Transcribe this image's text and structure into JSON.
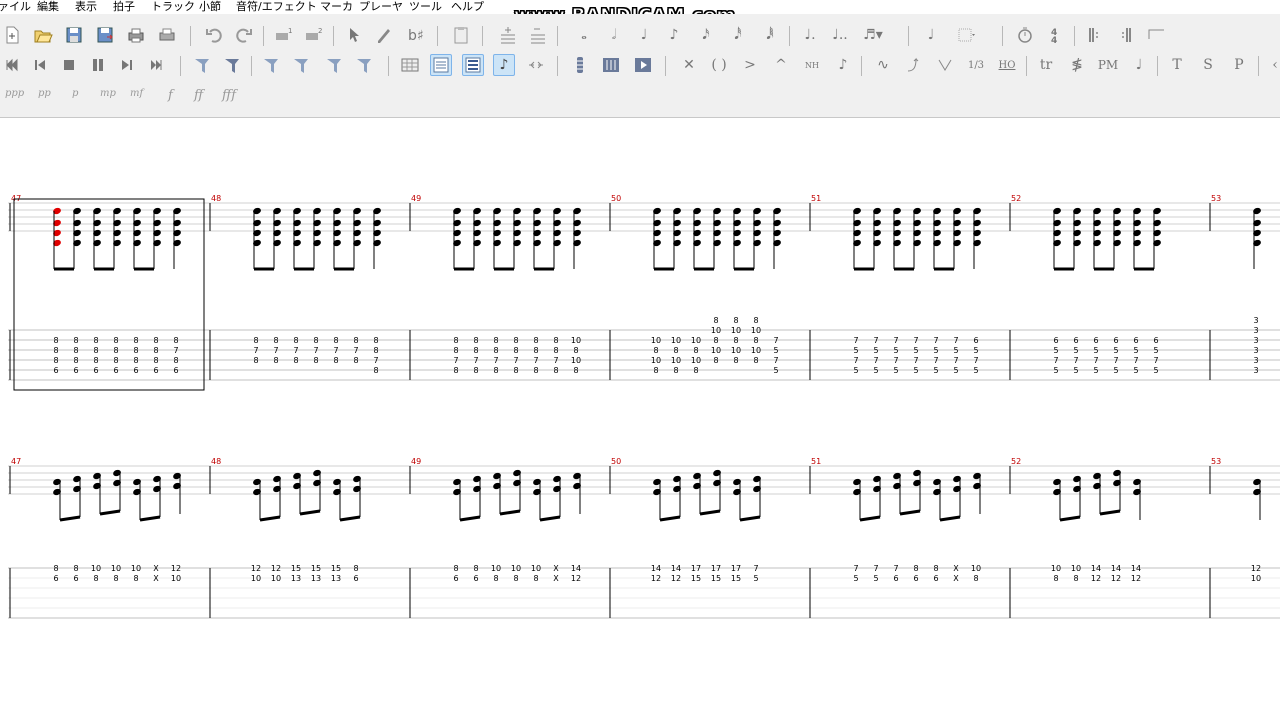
{
  "menu": {
    "items": [
      "ァイル",
      "編集",
      "表示",
      "拍子",
      "トラック",
      "小節",
      "音符/エフェクト",
      "マーカ",
      "プレーヤ",
      "ツール",
      "ヘルプ"
    ]
  },
  "watermark": "www.BANDICAM.com",
  "toolbar": {
    "dynamics": [
      "ppp",
      "pp",
      "p",
      "mp",
      "mf",
      "f",
      "ff",
      "fff"
    ],
    "letter_buttons": [
      "tr",
      "PM",
      "T",
      "S",
      "P"
    ],
    "fraction_label": "1/3",
    "ho_label": "HO",
    "nh_label": "NH",
    "active_icons": [
      "page-view-icon",
      "multitrack-view-icon",
      "note-view-icon"
    ]
  },
  "score": {
    "systems": [
      {
        "measures": [
          {
            "number": "47",
            "tab": [
              [
                "8",
                "8",
                "8",
                "6"
              ],
              [
                "8",
                "8",
                "8",
                "6"
              ],
              [
                "8",
                "8",
                "8",
                "6"
              ],
              [
                "8",
                "8",
                "8",
                "6"
              ],
              [
                "8",
                "8",
                "8",
                "6"
              ],
              [
                "8",
                "8",
                "8",
                "6"
              ],
              [
                "8",
                "7",
                "8",
                "6"
              ]
            ]
          },
          {
            "number": "48",
            "tab": [
              [
                "8",
                "7",
                "8",
                ""
              ],
              [
                "8",
                "7",
                "8",
                ""
              ],
              [
                "8",
                "7",
                "8",
                ""
              ],
              [
                "8",
                "7",
                "8",
                ""
              ],
              [
                "8",
                "7",
                "8",
                ""
              ],
              [
                "8",
                "7",
                "8",
                ""
              ],
              [
                "8",
                "8",
                "7",
                "8"
              ]
            ]
          },
          {
            "number": "49",
            "tab": [
              [
                "8",
                "8",
                "7",
                "8"
              ],
              [
                "8",
                "8",
                "7",
                "8"
              ],
              [
                "8",
                "8",
                "7",
                "8"
              ],
              [
                "8",
                "8",
                "7",
                "8"
              ],
              [
                "8",
                "8",
                "7",
                "8"
              ],
              [
                "8",
                "8",
                "7",
                "8"
              ],
              [
                "10",
                "8",
                "10",
                "8"
              ]
            ]
          },
          {
            "number": "50",
            "tab": [
              [
                "10",
                "8",
                "10",
                "8"
              ],
              [
                "10",
                "8",
                "10",
                "8"
              ],
              [
                "10",
                "8",
                "10",
                "8"
              ],
              [
                "8",
                "10",
                "8",
                "10",
                "8"
              ],
              [
                "8",
                "10",
                "8",
                "10",
                "8"
              ],
              [
                "8",
                "10",
                "8",
                "10",
                "8"
              ],
              [
                "7",
                "5",
                "7",
                "5"
              ]
            ]
          },
          {
            "number": "51",
            "tab": [
              [
                "7",
                "5",
                "7",
                "5"
              ],
              [
                "7",
                "5",
                "7",
                "5"
              ],
              [
                "7",
                "5",
                "7",
                "5"
              ],
              [
                "7",
                "5",
                "7",
                "5"
              ],
              [
                "7",
                "5",
                "7",
                "5"
              ],
              [
                "7",
                "5",
                "7",
                "5"
              ],
              [
                "6",
                "5",
                "7",
                "5"
              ]
            ]
          },
          {
            "number": "52",
            "tab": [
              [
                "6",
                "5",
                "7",
                "5"
              ],
              [
                "6",
                "5",
                "7",
                "5"
              ],
              [
                "6",
                "5",
                "7",
                "5"
              ],
              [
                "6",
                "5",
                "7",
                "5"
              ],
              [
                "6",
                "5",
                "7",
                "5"
              ],
              [
                "6",
                "5",
                "7",
                "5"
              ]
            ]
          },
          {
            "number": "53",
            "tab": [
              [
                "3",
                "3",
                "3",
                "3",
                "3",
                "3"
              ]
            ]
          }
        ]
      },
      {
        "measures": [
          {
            "number": "47",
            "tab": [
              [
                "8",
                "6"
              ],
              [
                "8",
                "6"
              ],
              [
                "10",
                "8"
              ],
              [
                "10",
                "8"
              ],
              [
                "10",
                "8"
              ],
              [
                "X",
                "X"
              ],
              [
                "12",
                "10"
              ]
            ]
          },
          {
            "number": "48",
            "tab": [
              [
                "12",
                "10"
              ],
              [
                "12",
                "10"
              ],
              [
                "15",
                "13"
              ],
              [
                "15",
                "13"
              ],
              [
                "15",
                "13"
              ],
              [
                "8",
                "6"
              ]
            ]
          },
          {
            "number": "49",
            "tab": [
              [
                "8",
                "6"
              ],
              [
                "8",
                "6"
              ],
              [
                "10",
                "8"
              ],
              [
                "10",
                "8"
              ],
              [
                "10",
                "8"
              ],
              [
                "X",
                "X"
              ],
              [
                "14",
                "12"
              ]
            ]
          },
          {
            "number": "50",
            "tab": [
              [
                "14",
                "12"
              ],
              [
                "14",
                "12"
              ],
              [
                "17",
                "15"
              ],
              [
                "17",
                "15"
              ],
              [
                "17",
                "15"
              ],
              [
                "7",
                "5"
              ]
            ]
          },
          {
            "number": "51",
            "tab": [
              [
                "7",
                "5"
              ],
              [
                "7",
                "5"
              ],
              [
                "7",
                "6"
              ],
              [
                "8",
                "6"
              ],
              [
                "8",
                "6"
              ],
              [
                "X",
                "X"
              ],
              [
                "10",
                "8"
              ]
            ]
          },
          {
            "number": "52",
            "tab": [
              [
                "10",
                "8"
              ],
              [
                "10",
                "8"
              ],
              [
                "14",
                "12"
              ],
              [
                "14",
                "12"
              ],
              [
                "14",
                "12"
              ]
            ]
          },
          {
            "number": "53",
            "tab": [
              [
                "12",
                "10"
              ]
            ]
          }
        ]
      }
    ]
  }
}
